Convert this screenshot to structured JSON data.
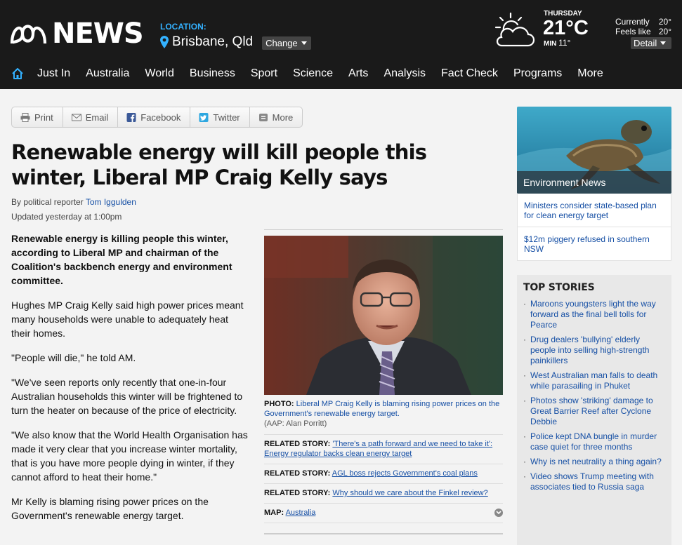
{
  "header": {
    "logo_text": "NEWS",
    "location_label": "LOCATION:",
    "city": "Brisbane, Qld",
    "change_label": "Change",
    "weather": {
      "day": "THURSDAY",
      "temp": "21°C",
      "min_label": "MIN",
      "min_value": "11°",
      "currently_label": "Currently",
      "currently_value": "20°",
      "feels_label": "Feels like",
      "feels_value": "20°",
      "detail_label": "Detail"
    }
  },
  "nav": [
    "Just In",
    "Australia",
    "World",
    "Business",
    "Sport",
    "Science",
    "Arts",
    "Analysis",
    "Fact Check",
    "Programs",
    "More"
  ],
  "share": [
    "Print",
    "Email",
    "Facebook",
    "Twitter",
    "More"
  ],
  "article": {
    "headline": "Renewable energy will kill people this winter, Liberal MP Craig Kelly says",
    "byline_prefix": "By political reporter",
    "author": "Tom Iggulden",
    "updated": "Updated yesterday at 1:00pm",
    "paragraphs": [
      "Renewable energy is killing people this winter, according to Liberal MP and chairman of the Coalition's backbench energy and environment committee.",
      "Hughes MP Craig Kelly said high power prices meant many households were unable to adequately heat their homes.",
      "\"People will die,\" he told AM.",
      "\"We've seen reports only recently that one-in-four Australian households this winter will be frightened to turn the heater on because of the price of electricity.",
      "\"We also know that the World Health Organisation has made it very clear that you increase winter mortality, that is you have more people dying in winter, if they cannot afford to heat their home.\"",
      "Mr Kelly is blaming rising power prices on the Government's renewable energy target."
    ]
  },
  "media": {
    "photo_label": "PHOTO:",
    "photo_caption": "Liberal MP Craig Kelly is blaming rising power prices on the Government's renewable energy target.",
    "photo_credit": "(AAP: Alan Porritt)",
    "related_label": "RELATED STORY:",
    "related": [
      "'There's a path forward and we need to take it': Energy regulator backs clean energy target",
      "AGL boss rejects Government's coal plans",
      "Why should we care about the Finkel review?"
    ],
    "map_label": "MAP:",
    "map_value": "Australia"
  },
  "sidebar": {
    "promo_label": "Environment News",
    "links": [
      "Ministers consider state-based plan for clean energy target",
      "$12m piggery refused in southern NSW"
    ],
    "top_stories_title": "TOP STORIES",
    "top_stories": [
      "Maroons youngsters light the way forward as the final bell tolls for Pearce",
      "Drug dealers 'bullying' elderly people into selling high-strength painkillers",
      "West Australian man falls to death while parasailing in Phuket",
      "Photos show 'striking' damage to Great Barrier Reef after Cyclone Debbie",
      "Police kept DNA bungle in murder case quiet for three months",
      "Why is net neutrality a thing again?",
      "Video shows Trump meeting with associates tied to Russia saga"
    ]
  },
  "colors": {
    "header_bg": "#1a1a1a",
    "accent_blue": "#33b1ff",
    "link_blue": "#1750a5"
  }
}
